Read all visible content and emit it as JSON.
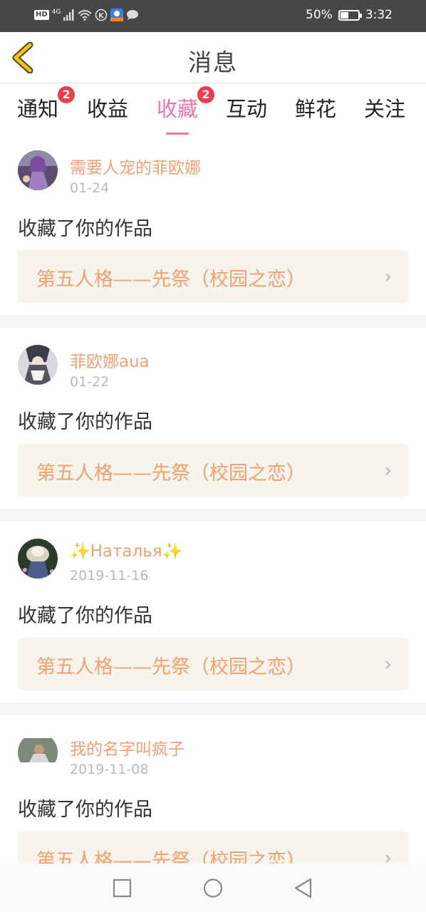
{
  "status_bar": {
    "network_label": "HD",
    "network_type": "4G",
    "battery_percent": "50%",
    "battery_level": 0.5,
    "time": "3:32",
    "icons": [
      "signal-icon",
      "wifi-icon",
      "k-icon",
      "app-notification-icon",
      "chat-bubble-icon"
    ]
  },
  "header": {
    "title": "消息",
    "back_icon": "chevron-left-icon",
    "back_color": "#f0c400"
  },
  "tabs": [
    {
      "label": "通知",
      "badge": "2"
    },
    {
      "label": "收益",
      "badge": ""
    },
    {
      "label": "收藏",
      "badge": "2",
      "active": true
    },
    {
      "label": "互动",
      "badge": ""
    },
    {
      "label": "鲜花",
      "badge": ""
    },
    {
      "label": "关注",
      "badge": ""
    }
  ],
  "messages": [
    {
      "username": "需要人宠的菲欧娜",
      "date": "01-24",
      "action": "收藏了你的作品",
      "work_title": "第五人格——先祭（校园之恋）"
    },
    {
      "username": "菲欧娜aua",
      "date": "01-22",
      "action": "收藏了你的作品",
      "work_title": "第五人格——先祭（校园之恋）"
    },
    {
      "username_prefix": "✨",
      "username": "Наталья",
      "username_suffix": "✨",
      "date": "2019-11-16",
      "action": "收藏了你的作品",
      "work_title": "第五人格——先祭（校园之恋）"
    },
    {
      "username": "我的名字叫疯子",
      "date": "2019-11-08",
      "action": "收藏了你的作品",
      "work_title": "第五人格——先祭（校园之恋）"
    }
  ],
  "nav_bar": {
    "icons": [
      "square-recent-icon",
      "circle-home-icon",
      "triangle-back-icon"
    ]
  },
  "colors": {
    "accent": "#ef74a7",
    "username": "#f0a073",
    "work_title": "#f2a06d",
    "badge": "#f03c4b",
    "work_box_bg": "#f6f4ec"
  }
}
